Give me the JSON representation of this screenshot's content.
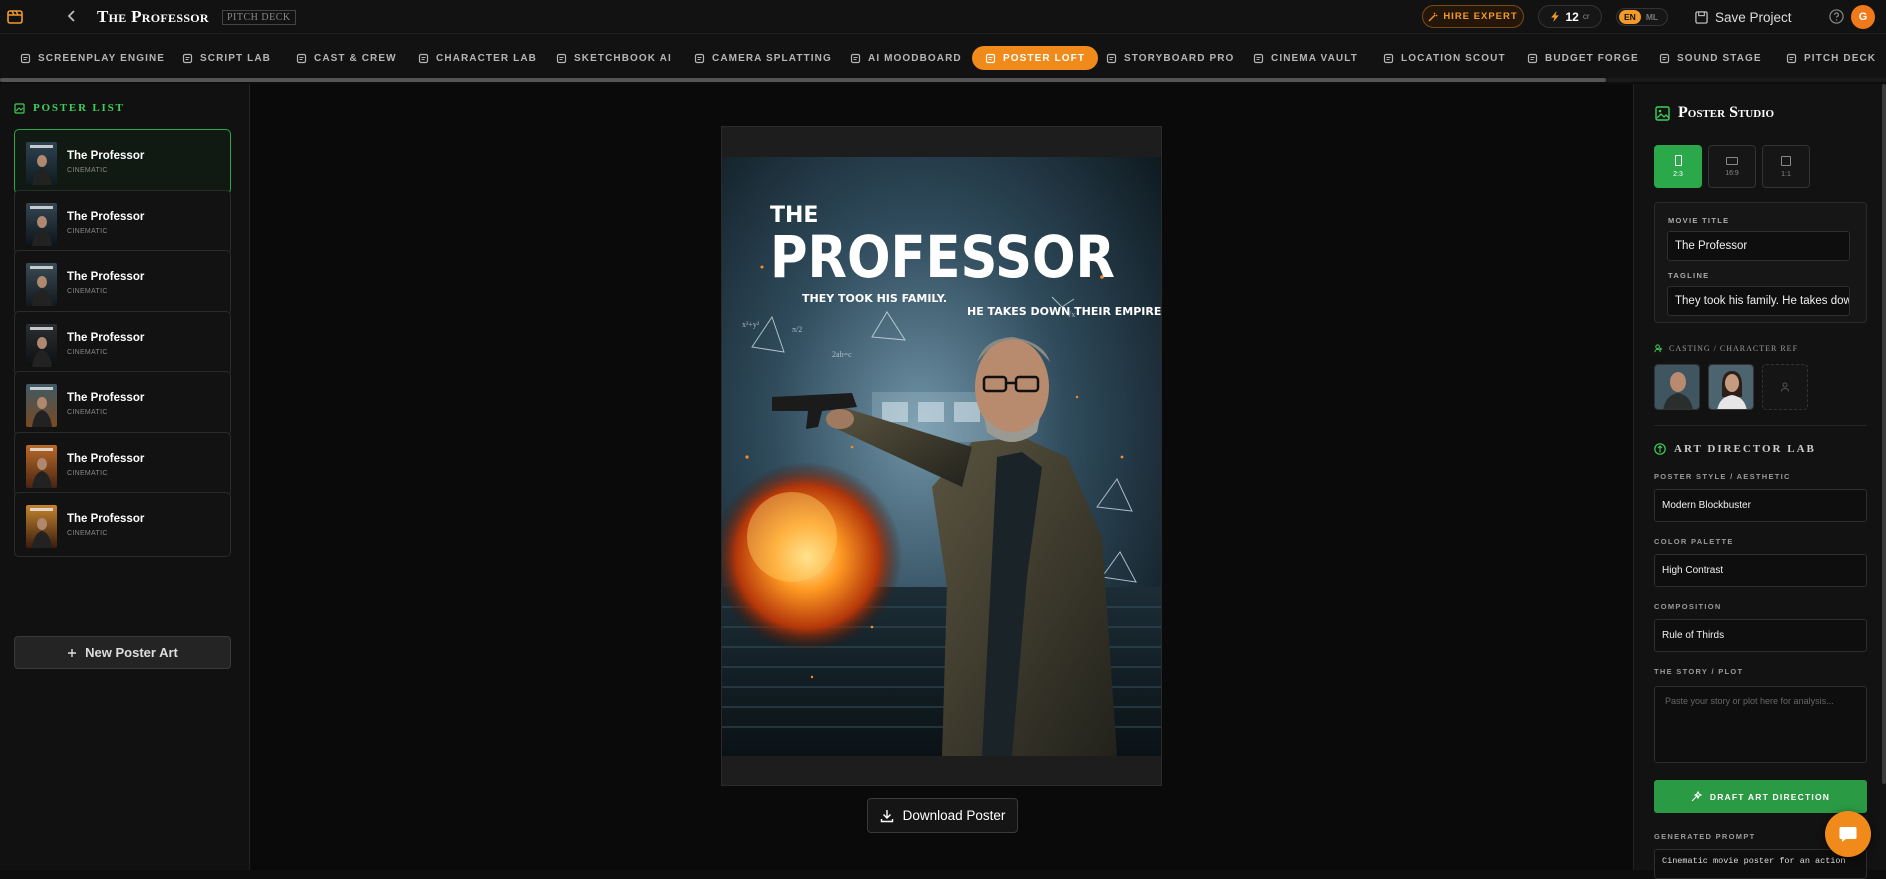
{
  "header": {
    "project_title": "The Professor",
    "badge": "PITCH DECK",
    "hire_label": "HIRE EXPERT",
    "credits": "12",
    "credits_unit": "cr",
    "lang_active": "EN",
    "lang_other": "ML",
    "save_label": "Save Project",
    "avatar_initial": "G"
  },
  "nav": {
    "items": [
      {
        "label": "SCREENPLAY ENGINE",
        "icon": "script-icon"
      },
      {
        "label": "SCRIPT LAB",
        "icon": "script-lab-icon"
      },
      {
        "label": "CAST & CREW",
        "icon": "users-icon"
      },
      {
        "label": "CHARACTER LAB",
        "icon": "user-icon"
      },
      {
        "label": "SKETCHBOOK AI",
        "icon": "pencil-icon"
      },
      {
        "label": "CAMERA SPLATTING",
        "icon": "frame-icon"
      },
      {
        "label": "AI MOODBOARD",
        "icon": "palette-icon"
      },
      {
        "label": "POSTER LOFT",
        "icon": "poster-icon",
        "active": true
      },
      {
        "label": "STORYBOARD PRO",
        "icon": "film-icon"
      },
      {
        "label": "CINEMA VAULT",
        "icon": "cube-icon"
      },
      {
        "label": "LOCATION SCOUT",
        "icon": "pin-icon"
      },
      {
        "label": "BUDGET FORGE",
        "icon": "calc-icon"
      },
      {
        "label": "SOUND STAGE",
        "icon": "mic-icon"
      },
      {
        "label": "PITCH DECK",
        "icon": "deck-icon"
      }
    ]
  },
  "sidebar": {
    "heading": "POSTER LIST",
    "items": [
      {
        "title": "The Professor",
        "style": "CINEMATIC"
      },
      {
        "title": "The Professor",
        "style": "CINEMATIC"
      },
      {
        "title": "The Professor",
        "style": "CINEMATIC"
      },
      {
        "title": "The Professor",
        "style": "CINEMATIC"
      },
      {
        "title": "The Professor",
        "style": "CINEMATIC"
      },
      {
        "title": "The Professor",
        "style": "CINEMATIC"
      },
      {
        "title": "The Professor",
        "style": "CINEMATIC"
      }
    ],
    "new_label": "New Poster Art"
  },
  "poster": {
    "title_top": "THE",
    "title_main": "PROFESSOR",
    "tag_left": "THEY TOOK HIS FAMILY.",
    "tag_right": "HE TAKES DOWN THEIR EMPIRE."
  },
  "download_label": "Download Poster",
  "studio": {
    "heading": "Poster Studio",
    "ratios": [
      "2:3",
      "16:9",
      "1:1"
    ],
    "movie_title_label": "MOVIE TITLE",
    "movie_title_value": "The Professor",
    "tagline_label": "TAGLINE",
    "tagline_value": "They took his family. He takes down their empire.",
    "casting_label": "CASTING / CHARACTER REF",
    "adl_heading": "ART DIRECTOR LAB",
    "style_label": "POSTER STYLE / AESTHETIC",
    "style_value": "Modern Blockbuster",
    "palette_label": "COLOR PALETTE",
    "palette_value": "High Contrast",
    "composition_label": "COMPOSITION",
    "composition_value": "Rule of Thirds",
    "story_label": "THE STORY / PLOT",
    "story_placeholder": "Paste your story or plot here for analysis...",
    "draft_label": "DRAFT ART DIRECTION",
    "generated_label": "GENERATED PROMPT",
    "generated_value": "Cinematic movie poster for an action"
  },
  "colors": {
    "accent": "#f08a1a",
    "green": "#2aa84a"
  }
}
